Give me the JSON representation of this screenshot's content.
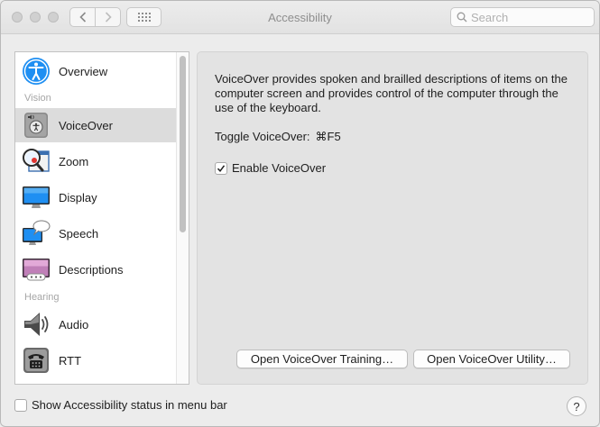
{
  "window": {
    "title": "Accessibility"
  },
  "toolbar": {
    "back_icon": "chevron-left-icon",
    "forward_icon": "chevron-right-icon",
    "grid_icon": "grid-icon",
    "search_placeholder": "Search",
    "search_value": ""
  },
  "sidebar": {
    "sections": {
      "vision": "Vision",
      "hearing": "Hearing"
    },
    "items": [
      {
        "label": "Overview",
        "icon": "accessibility-person-icon",
        "selected": false
      },
      {
        "label": "VoiceOver",
        "icon": "voiceover-icon",
        "selected": true
      },
      {
        "label": "Zoom",
        "icon": "zoom-window-icon",
        "selected": false
      },
      {
        "label": "Display",
        "icon": "display-monitor-icon",
        "selected": false
      },
      {
        "label": "Speech",
        "icon": "speech-bubble-icon",
        "selected": false
      },
      {
        "label": "Descriptions",
        "icon": "descriptions-icon",
        "selected": false
      },
      {
        "label": "Audio",
        "icon": "speaker-icon",
        "selected": false
      },
      {
        "label": "RTT",
        "icon": "telephone-icon",
        "selected": false
      }
    ]
  },
  "main": {
    "description": "VoiceOver provides spoken and brailled descriptions of items on the computer screen and provides control of the computer through the use of the keyboard.",
    "toggle_label": "Toggle VoiceOver:",
    "toggle_shortcut": "⌘F5",
    "enable_label": "Enable VoiceOver",
    "enable_checked": true,
    "training_button": "Open VoiceOver Training…",
    "utility_button": "Open VoiceOver Utility…"
  },
  "footer": {
    "status_label": "Show Accessibility status in menu bar",
    "status_checked": false,
    "help_label": "?"
  },
  "colors": {
    "selected_row": "#dcdcdc",
    "accessibility_blue": "#1f8ff2",
    "pane_background": "#e3e3e3"
  }
}
